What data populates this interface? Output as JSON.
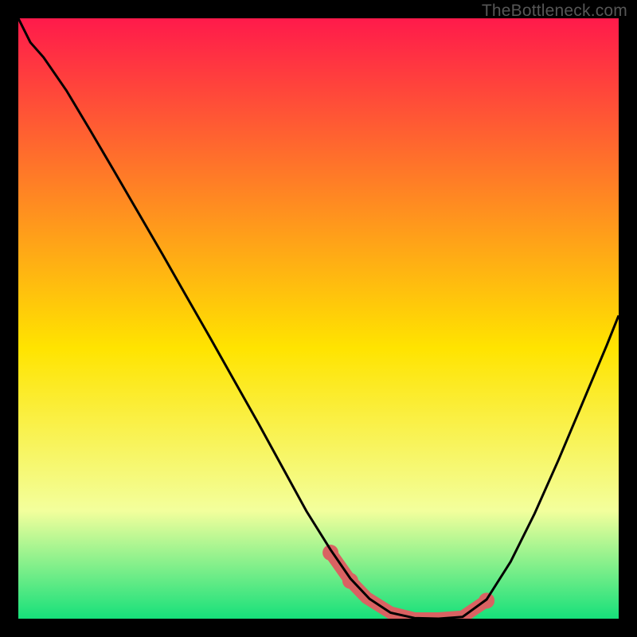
{
  "watermark": "TheBottleneck.com",
  "colors": {
    "grad_top": "#ff1a4b",
    "grad_mid": "#ffe400",
    "grad_low": "#f3ff9c",
    "grad_bot": "#16e07a",
    "curve": "#000000",
    "accent": "#d96262"
  },
  "chart_data": {
    "type": "line",
    "title": "",
    "xlabel": "",
    "ylabel": "",
    "xlim": [
      0,
      1
    ],
    "ylim": [
      0,
      1
    ],
    "series": [
      {
        "name": "curve",
        "x": [
          0.0,
          0.02,
          0.042,
          0.08,
          0.12,
          0.16,
          0.2,
          0.24,
          0.28,
          0.32,
          0.36,
          0.4,
          0.44,
          0.48,
          0.52,
          0.553,
          0.585,
          0.62,
          0.66,
          0.7,
          0.74,
          0.78,
          0.82,
          0.86,
          0.9,
          0.94,
          0.98,
          1.0
        ],
        "y": [
          1.0,
          0.96,
          0.935,
          0.88,
          0.813,
          0.745,
          0.676,
          0.607,
          0.537,
          0.467,
          0.396,
          0.325,
          0.252,
          0.179,
          0.115,
          0.067,
          0.033,
          0.01,
          0.001,
          0.0,
          0.003,
          0.032,
          0.095,
          0.175,
          0.265,
          0.36,
          0.455,
          0.505
        ]
      },
      {
        "name": "accent-band",
        "x": [
          0.52,
          0.553,
          0.58,
          0.62,
          0.66,
          0.7,
          0.74,
          0.78
        ],
        "y": [
          0.11,
          0.063,
          0.035,
          0.01,
          0.0,
          0.0,
          0.003,
          0.03
        ]
      }
    ],
    "accent_dots": [
      {
        "x": 0.52,
        "y": 0.11
      },
      {
        "x": 0.553,
        "y": 0.063
      },
      {
        "x": 0.78,
        "y": 0.03
      }
    ]
  }
}
